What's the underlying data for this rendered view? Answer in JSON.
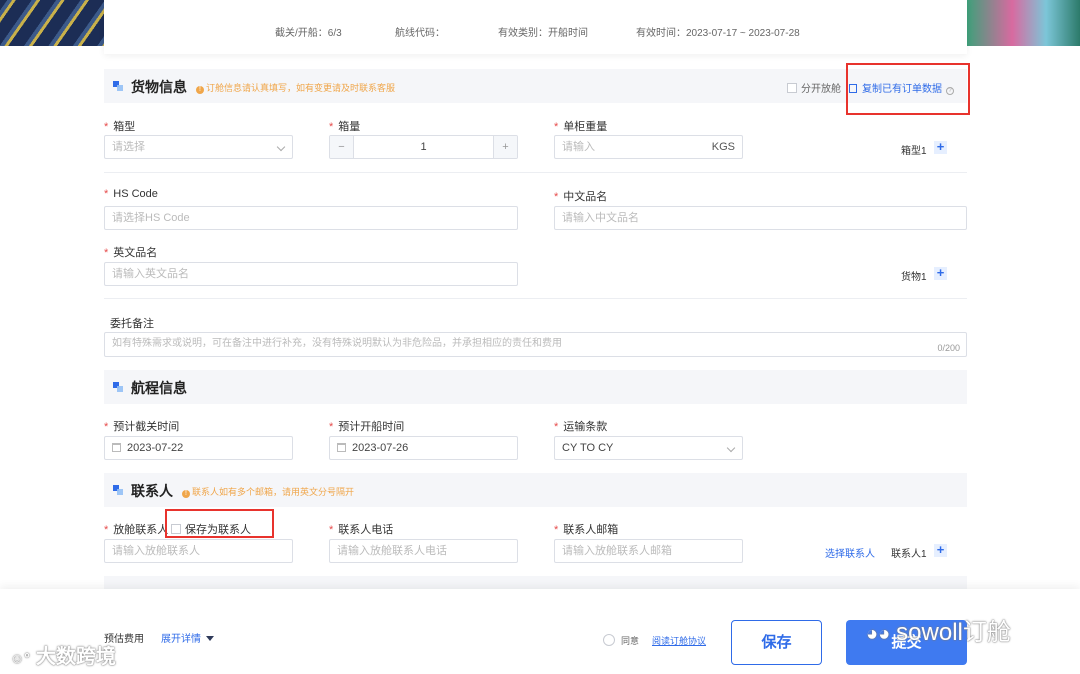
{
  "infobar": {
    "cutoff": "截关/开船：6/3",
    "route_code": "航线代码：",
    "valid_type": "有效类别：开船时间",
    "valid_time": "有效时间：2023-07-17 ~ 2023-07-28"
  },
  "cargo": {
    "title": "货物信息",
    "note": "订舱信息请认真填写，如有变更请及时联系客服",
    "split_label": "分开放舱",
    "copy_label": "复制已有订单数据",
    "container_type_label": "箱型",
    "container_type_placeholder": "请选择",
    "quantity_label": "箱量",
    "quantity_value": "1",
    "quantity_minus": "−",
    "quantity_plus": "+",
    "weight_label": "单柜重量",
    "weight_placeholder": "请输入",
    "weight_unit": "KGS",
    "container_row_label": "箱型1",
    "hs_label": "HS Code",
    "hs_placeholder": "请选择HS Code",
    "cn_name_label": "中文品名",
    "cn_name_placeholder": "请输入中文品名",
    "en_name_label": "英文品名",
    "en_name_placeholder": "请输入英文品名",
    "goods_row_label": "货物1",
    "remark_label": "委托备注",
    "remark_placeholder": "如有特殊需求或说明，可在备注中进行补充，没有特殊说明默认为非危险品，并承担相应的责任和费用",
    "remark_counter": "0/200"
  },
  "voyage": {
    "title": "航程信息",
    "cutoff_label": "预计截关时间",
    "cutoff_value": "2023-07-22",
    "sail_label": "预计开船时间",
    "sail_value": "2023-07-26",
    "terms_label": "运输条款",
    "terms_value": "CY TO CY"
  },
  "contact": {
    "title": "联系人",
    "note": "联系人如有多个邮箱，请用英文分号隔开",
    "name_label": "放舱联系人",
    "save_label": "保存为联系人",
    "name_placeholder": "请输入放舱联系人",
    "phone_label": "联系人电话",
    "phone_placeholder": "请输入放舱联系人电话",
    "email_label": "联系人邮箱",
    "email_placeholder": "请输入放舱联系人邮箱",
    "select_link": "选择联系人",
    "row_label": "联系人1"
  },
  "footer": {
    "fee_label": "预估费用",
    "expand_label": "展开详情",
    "agree_label": "同意",
    "agreement_link": "阅读订舱协议",
    "save_button": "保存",
    "submit_button": "提交"
  },
  "watermark": {
    "left": "大数跨境",
    "right": "sowoll订舱"
  },
  "colors": {
    "primary": "#2f6be8",
    "warning": "#f0a64a",
    "required": "#e64a4a",
    "highlight_box": "#e8332d"
  }
}
